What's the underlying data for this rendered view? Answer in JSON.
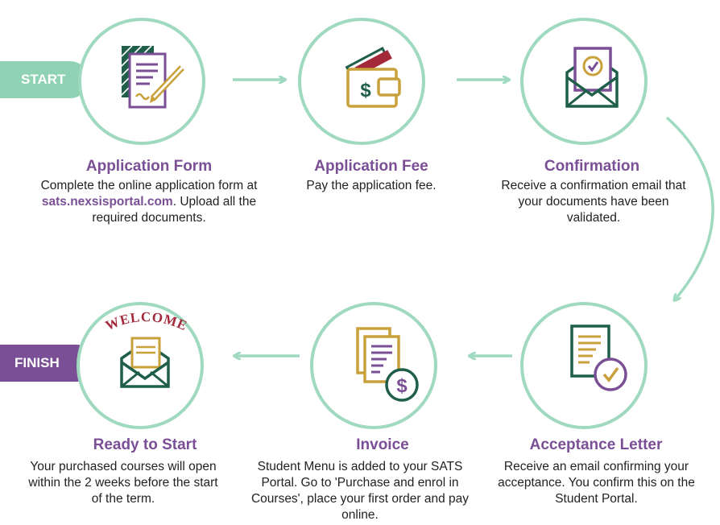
{
  "start_label": "START",
  "finish_label": "FINISH",
  "steps": [
    {
      "title": "Application Form",
      "desc_pre": "Complete the online application form at ",
      "desc_link": "sats.nexsisportal.com",
      "desc_post": ". Upload all the required documents.",
      "icon": "application-form-icon"
    },
    {
      "title": "Application Fee",
      "desc": "Pay the application fee.",
      "icon": "wallet-dollar-icon"
    },
    {
      "title": "Confirmation",
      "desc": "Receive a confirmation email that your documents have been validated.",
      "icon": "envelope-check-icon"
    },
    {
      "title": "Acceptance Letter",
      "desc": "Receive an email confirming your acceptance. You confirm this on the Student Portal.",
      "icon": "letter-check-icon"
    },
    {
      "title": "Invoice",
      "desc": "Student Menu is added to your SATS Portal. Go to 'Purchase and enrol in Courses', place your first order and pay online.",
      "icon": "invoice-dollar-icon"
    },
    {
      "title": "Ready to Start",
      "desc": "Your purchased courses will open within the 2 weeks before the start of the term.",
      "icon": "welcome-envelope-icon",
      "banner": "WELCOME"
    }
  ],
  "colors": {
    "green": "#9fd9bf",
    "start_green": "#8ed2b3",
    "purple": "#7a4f96",
    "dark_green": "#1f5f4a",
    "gold": "#c9a13b",
    "red": "#a3283a"
  }
}
